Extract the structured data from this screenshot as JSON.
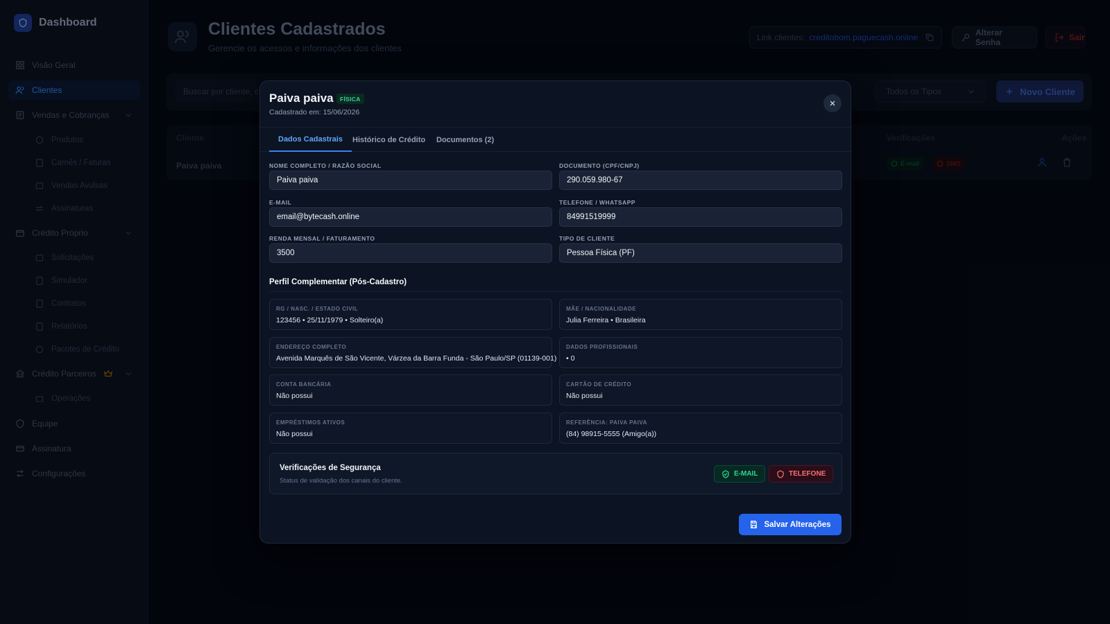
{
  "brand": {
    "title": "Dashboard"
  },
  "nav": {
    "visao_geral": "Visão Geral",
    "clientes": "Clientes",
    "vendas": "Vendas e Cobranças",
    "produtos": "Produtos",
    "carnes": "Carnês / Faturas",
    "vendas_avulsas": "Vendas Avulsas",
    "assinaturas": "Assinaturas",
    "credito_proprio": "Crédito Próprio",
    "solicitacoes": "Solicitações",
    "simulador": "Simulador",
    "contratos": "Contratos",
    "relatorios": "Relatórios",
    "pacotes": "Pacotes de Crédito",
    "credito_parceiros": "Crédito Parceiros",
    "operacoes": "Operações",
    "equipe": "Equipe",
    "assinatura": "Assinatura",
    "configuracoes": "Configurações"
  },
  "header": {
    "title": "Clientes Cadastrados",
    "subtitle": "Gerencie os acessos e informações dos clientes",
    "link_label": "Link clientes:",
    "link_value": "creditobom.paguecash.online",
    "change_password": "Alterar Senha",
    "logout": "Sair"
  },
  "toolbar": {
    "search_placeholder": "Buscar por cliente, d",
    "filter_value": "Todos os Tipos",
    "new_client": "Novo Cliente"
  },
  "table": {
    "col_client": "Cliente",
    "col_verifications": "Verificações",
    "col_actions": "Ações",
    "row_name": "Paiva paiva",
    "chip_email": "E-mail",
    "chip_sms": "SMS"
  },
  "modal": {
    "title": "Paiva paiva",
    "badge": "FÍSICA",
    "subtitle": "Cadastrado em: 15/06/2026",
    "tabs": {
      "dados": "Dados Cadastrais",
      "historico": "Histórico de Crédito",
      "documentos": "Documentos (2)"
    },
    "fields": {
      "nome_label": "Nome Completo / Razão Social",
      "nome_value": "Paiva paiva",
      "doc_label": "Documento (CPF/CNPJ)",
      "doc_value": "290.059.980-67",
      "email_label": "E-mail",
      "email_value": "email@bytecash.online",
      "tel_label": "Telefone / WhatsApp",
      "tel_value": "84991519999",
      "renda_label": "Renda Mensal / Faturamento",
      "renda_value": "3500",
      "tipo_label": "Tipo de Cliente",
      "tipo_value": "Pessoa Física (PF)"
    },
    "profile_title": "Perfil Complementar (Pós-Cadastro)",
    "cards": {
      "rg_label": "RG / Nasc. / Estado Civil",
      "rg_value": "123456 • 25/11/1979 • Solteiro(a)",
      "mae_label": "Mãe / Nacionalidade",
      "mae_value": "Julia Ferreira • Brasileira",
      "end_label": "Endereço Completo",
      "end_value": "Avenida Marquês de São Vicente, Várzea da Barra Funda - São Paulo/SP (01139-001)",
      "prof_label": "Dados Profissionais",
      "prof_value": "• 0",
      "conta_label": "Conta Bancária",
      "conta_value": "Não possui",
      "cartao_label": "Cartão de Crédito",
      "cartao_value": "Não possui",
      "emp_label": "Empréstimos Ativos",
      "emp_value": "Não possui",
      "ref_label": "Referência: Paiva paiva",
      "ref_value": "(84) 98915-5555 (Amigo(a))"
    },
    "security": {
      "title": "Verificações de Segurança",
      "subtitle": "Status de validação dos canais do cliente.",
      "email_badge": "E-MAIL",
      "phone_badge": "TELEFONE"
    },
    "save": "Salvar Alterações"
  },
  "colors": {
    "accent": "#2563eb",
    "success": "#34d399",
    "danger": "#f87171",
    "background": "#050914"
  }
}
